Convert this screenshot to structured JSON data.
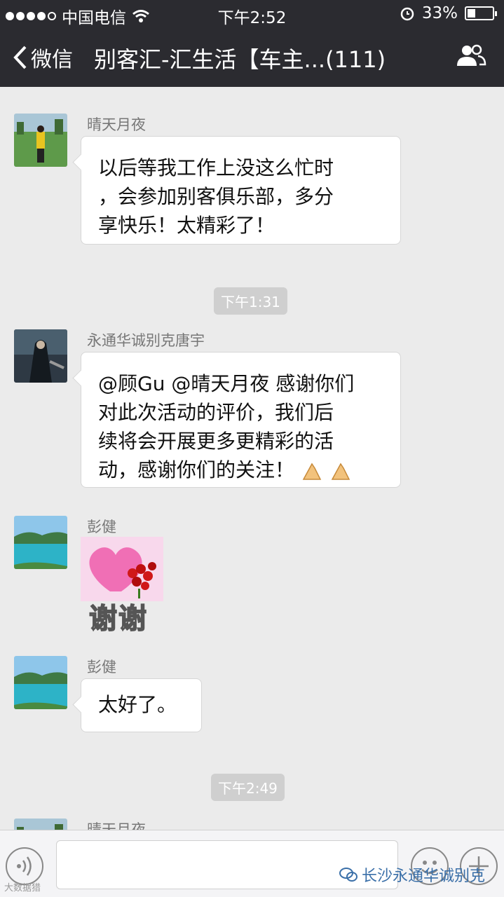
{
  "status_bar": {
    "carrier": "中国电信",
    "time": "下午2:52",
    "battery": "33%",
    "battery_level": 0.33
  },
  "nav": {
    "back_label": "微信",
    "title": "别客汇-汇生活【车主...(111)"
  },
  "messages": [
    {
      "sender": "晴天月夜",
      "lines": [
        "以后等我工作上没这么忙时",
        "，会参加别客俱乐部，多分",
        "享快乐！太精彩了！"
      ]
    },
    {
      "time": "下午1:31"
    },
    {
      "sender": "永通华诚别克唐宇",
      "lines": [
        "@顾Gu @晴天月夜 感谢你们",
        "对此次活动的评价，我们后",
        "续将会开展更多更精彩的活",
        "动，感谢你们的关注！"
      ]
    },
    {
      "sender": "彭健",
      "sticker_text": "谢谢"
    },
    {
      "sender": "彭健",
      "text": "太好了。"
    },
    {
      "time": "下午2:49"
    },
    {
      "sender": "晴天月夜"
    }
  ],
  "watermark": {
    "text": "长沙永通华诚别克",
    "small_text": "大数据猎"
  }
}
